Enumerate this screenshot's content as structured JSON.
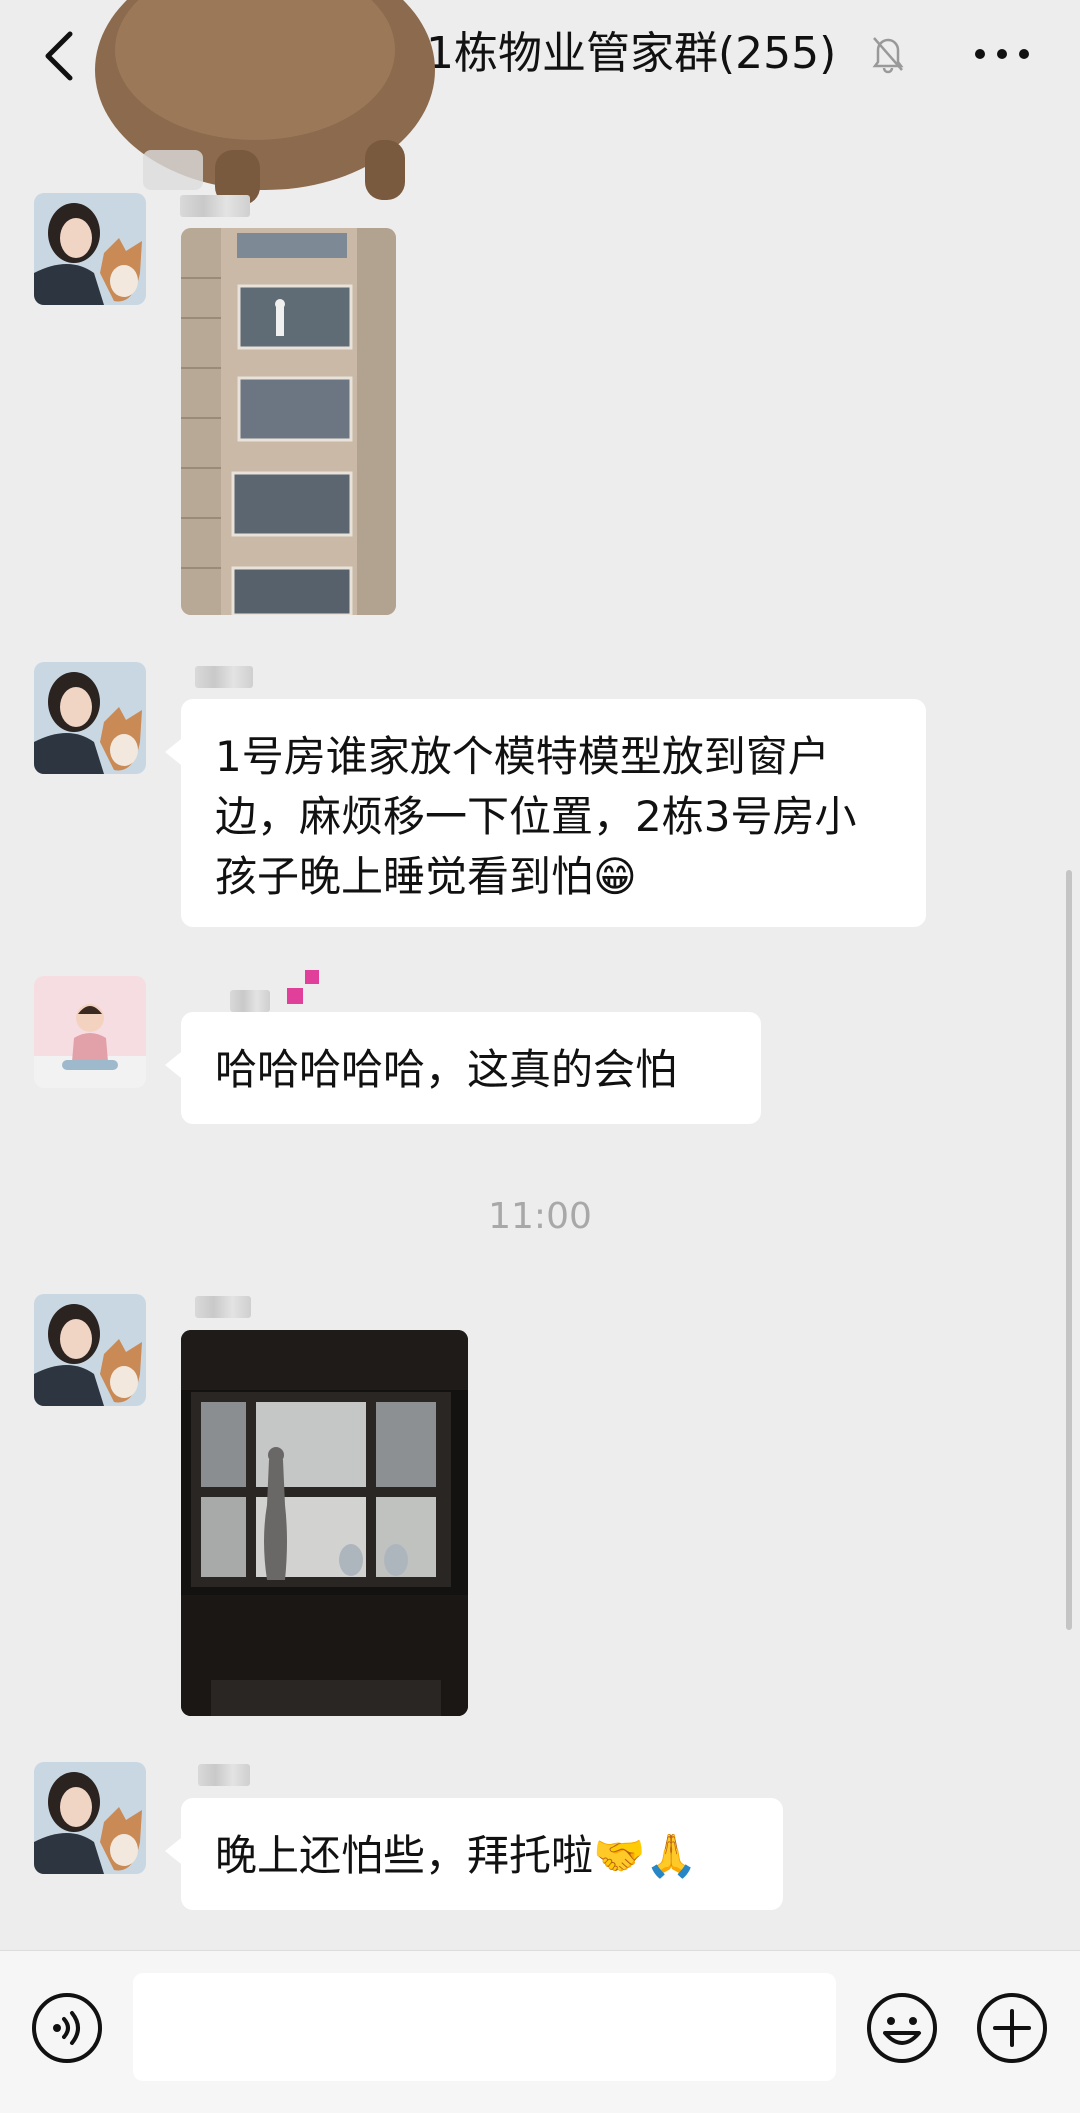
{
  "header": {
    "title": "1栋物业管家群(255)",
    "back_icon": "chevron-left-icon",
    "mute_icon": "bell-off-icon",
    "more_icon": "more-dots-icon"
  },
  "messages": [
    {
      "type": "image",
      "sender_avatar": "woman-with-dog-avatar",
      "image": "building-facade-photo"
    },
    {
      "type": "text",
      "sender_avatar": "woman-with-dog-avatar",
      "text": "1号房谁家放个模特模型放到窗户边，麻烦移一下位置，2栋3号房小孩子晚上睡觉看到怕😁"
    },
    {
      "type": "text",
      "sender_avatar": "child-avatar",
      "text": "哈哈哈哈哈，这真的会怕"
    },
    {
      "type": "image",
      "sender_avatar": "woman-with-dog-avatar",
      "image": "night-window-photo"
    },
    {
      "type": "text",
      "sender_avatar": "woman-with-dog-avatar",
      "text": "晚上还怕些，拜托啦🤝🙏"
    }
  ],
  "timestamp": "11:00",
  "input_bar": {
    "placeholder": "",
    "voice_icon": "voice-input-icon",
    "emoji_icon": "emoji-face-icon",
    "plus_icon": "plus-circle-icon"
  },
  "colors": {
    "background": "#ededed",
    "bubble": "#ffffff",
    "text": "#111111",
    "timestamp": "#a8a8a8"
  }
}
